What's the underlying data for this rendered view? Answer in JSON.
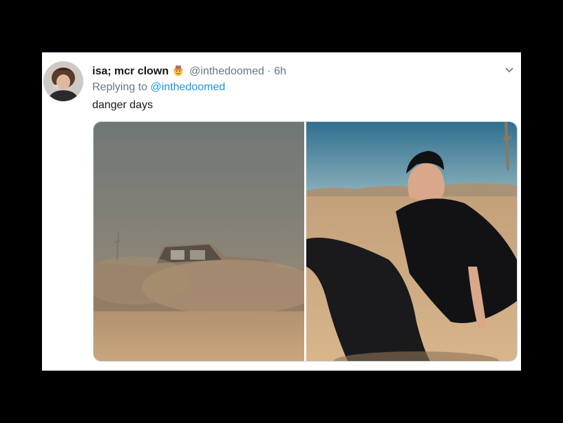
{
  "tweet": {
    "display_name": "isa; mcr clown",
    "handle": "@inthedoomed",
    "separator": "·",
    "time": "6h",
    "replying_prefix": "Replying to",
    "replying_to": "@inthedoomed",
    "text": "danger days",
    "emoji_icon": "cowboy-hat-face-icon",
    "menu_icon": "chevron-down-icon"
  },
  "colors": {
    "background": "#000000",
    "card": "#ffffff",
    "name": "#14171a",
    "secondary": "#657786",
    "link": "#1b95e0"
  }
}
